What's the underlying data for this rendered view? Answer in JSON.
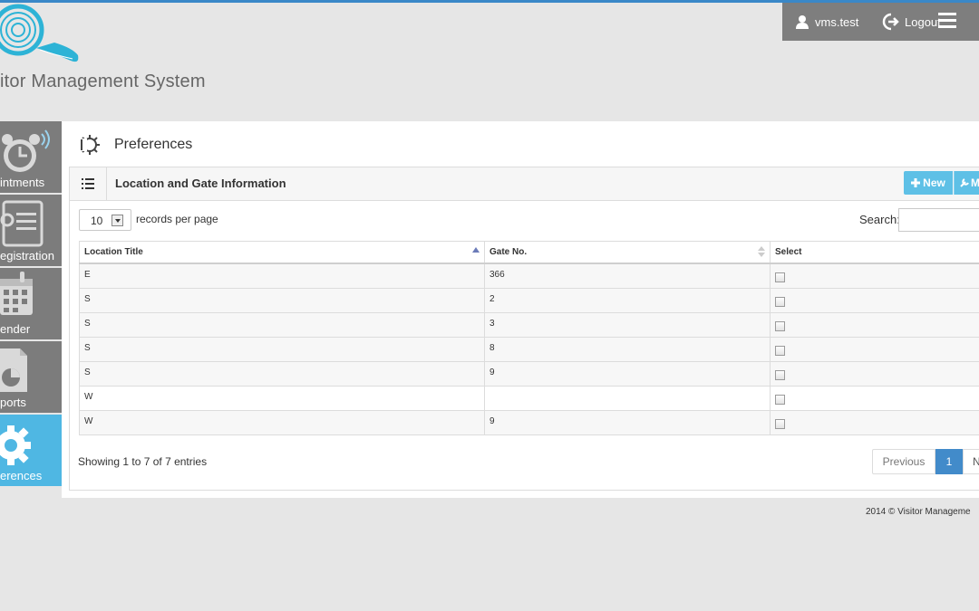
{
  "brand": {
    "name": "itor Management System"
  },
  "header": {
    "username": "vms.test",
    "logout_label": "Logout"
  },
  "sidebar": {
    "items": [
      {
        "label": "intments",
        "icon": "clock-icon"
      },
      {
        "label": "egistration",
        "icon": "registration-icon"
      },
      {
        "label": "ender",
        "icon": "calendar-icon"
      },
      {
        "label": "ports",
        "icon": "report-icon"
      },
      {
        "label": "erences",
        "icon": "gear-icon",
        "active": true
      }
    ]
  },
  "page": {
    "title": "Preferences"
  },
  "panel": {
    "title": "Location and Gate Information",
    "new_label": "New",
    "more_label": "M"
  },
  "table_controls": {
    "page_length": "10",
    "records_label": "records per page",
    "search_label": "Search:"
  },
  "table": {
    "headers": [
      "Location Title",
      "Gate No.",
      "Select"
    ],
    "rows": [
      {
        "location": "E",
        "gate": "366"
      },
      {
        "location": "S",
        "gate": "2"
      },
      {
        "location": "S",
        "gate": "3"
      },
      {
        "location": "S",
        "gate": "8"
      },
      {
        "location": "S",
        "gate": "9"
      },
      {
        "location": "W",
        "gate": ""
      },
      {
        "location": "W",
        "gate": "9"
      }
    ]
  },
  "footer_info": "Showing 1 to 7 of 7 entries",
  "pagination": {
    "previous": "Previous",
    "current": "1",
    "next": "N"
  },
  "copyright": "2014 © Visitor Manageme",
  "colors": {
    "accent": "#4fb7e3",
    "header_bar": "#7e7e7e",
    "sidebar": "#7c7c7c",
    "pager_active": "#428bca"
  }
}
